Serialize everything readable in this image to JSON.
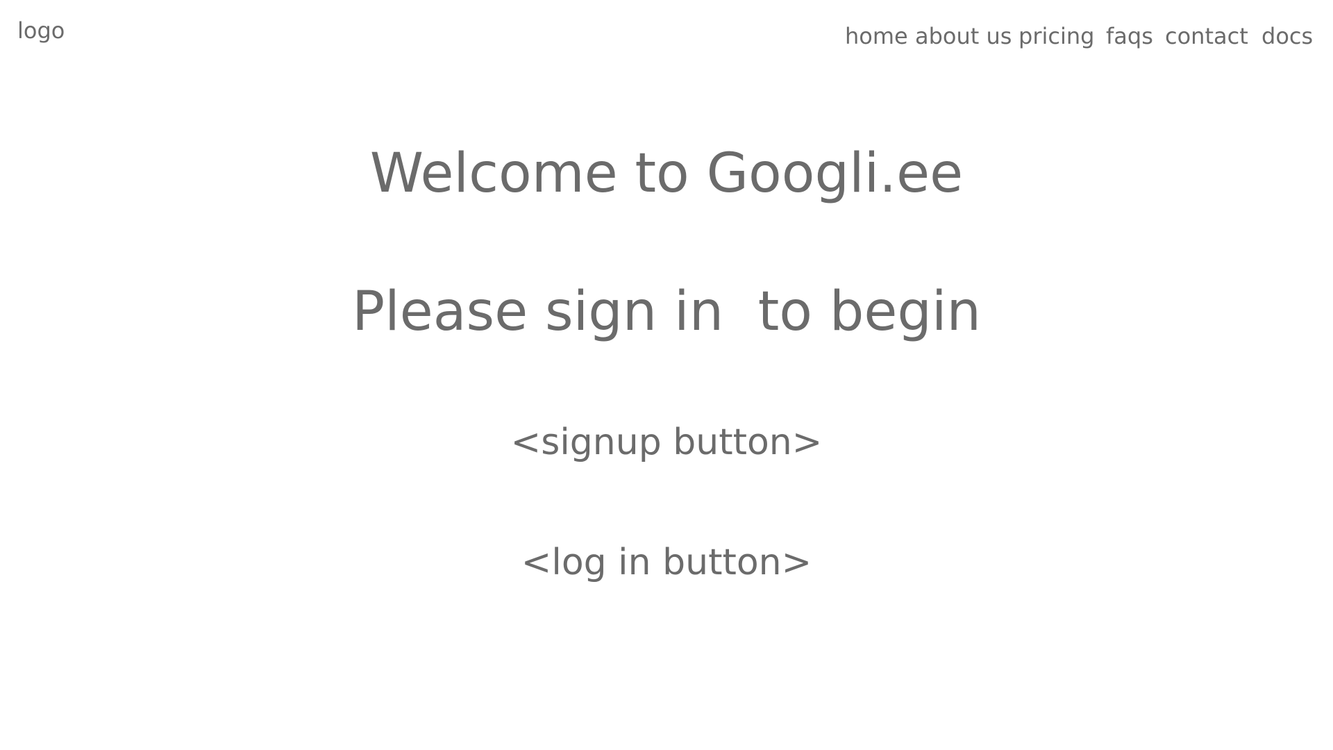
{
  "header": {
    "logo_text": "logo",
    "nav": [
      {
        "label": "home"
      },
      {
        "label": "about us"
      },
      {
        "label": "pricing"
      },
      {
        "label": "faqs"
      },
      {
        "label": "contact"
      },
      {
        "label": "docs"
      }
    ]
  },
  "main": {
    "welcome_heading": "Welcome to Googli.ee",
    "subheading": "Please sign in  to begin",
    "signup_button": "<signup button>",
    "login_button": "<log in button>"
  },
  "colors": {
    "text": "#6b6b6b",
    "background": "#ffffff"
  }
}
